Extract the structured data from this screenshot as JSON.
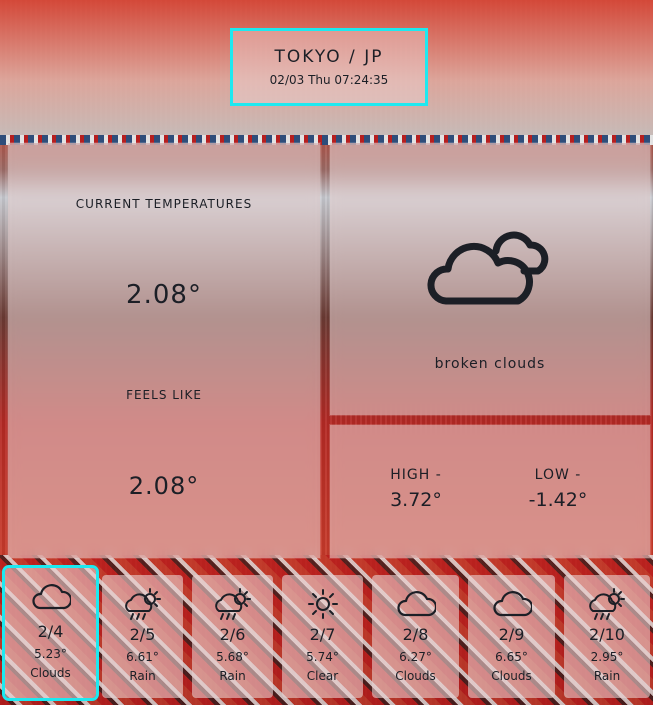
{
  "header": {
    "city": "TOKYO / JP",
    "datetime": "02/03 Thu 07:24:35"
  },
  "current": {
    "temp_label": "CURRENT TEMPERATURES",
    "temp_value": "2.08°",
    "feels_label": "FEELS LIKE",
    "feels_value": "2.08°",
    "description": "broken clouds",
    "icon": "broken-clouds-icon"
  },
  "hilo": {
    "high_label": "HIGH -",
    "high_value": "3.72°",
    "low_label": "LOW -",
    "low_value": "-1.42°"
  },
  "forecast": [
    {
      "date": "2/4",
      "temp": "5.23°",
      "condition": "Clouds",
      "icon": "cloud-icon"
    },
    {
      "date": "2/5",
      "temp": "6.61°",
      "condition": "Rain",
      "icon": "rain-sun-icon"
    },
    {
      "date": "2/6",
      "temp": "5.68°",
      "condition": "Rain",
      "icon": "rain-sun-icon"
    },
    {
      "date": "2/7",
      "temp": "5.74°",
      "condition": "Clear",
      "icon": "sun-icon"
    },
    {
      "date": "2/8",
      "temp": "6.27°",
      "condition": "Clouds",
      "icon": "cloud-icon"
    },
    {
      "date": "2/9",
      "temp": "6.65°",
      "condition": "Clouds",
      "icon": "cloud-icon"
    },
    {
      "date": "2/10",
      "temp": "2.95°",
      "condition": "Rain",
      "icon": "rain-sun-icon"
    }
  ],
  "colors": {
    "highlight": "#1de9f0",
    "text": "#1c1f26"
  }
}
